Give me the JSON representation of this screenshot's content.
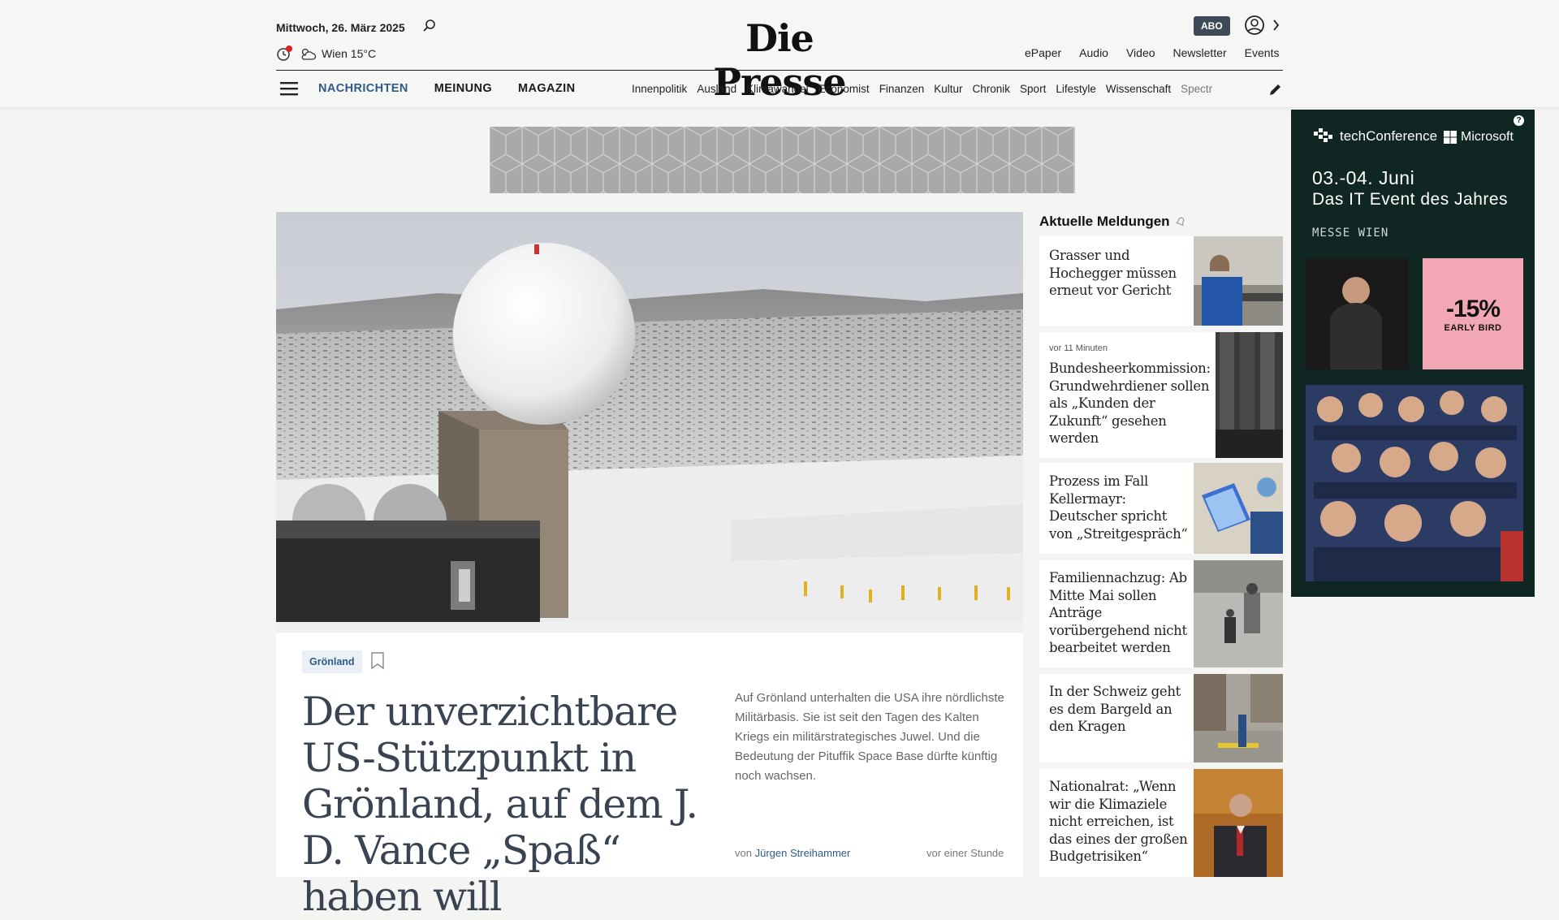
{
  "header": {
    "date": "Mittwoch, 26. März 2025",
    "weather": "Wien 15°C",
    "logo": "Die Presse",
    "abo_label": "ABO",
    "top_links": [
      "ePaper",
      "Audio",
      "Video",
      "Newsletter",
      "Events"
    ]
  },
  "nav": {
    "main": [
      "NACHRICHTEN",
      "MEINUNG",
      "MAGAZIN"
    ],
    "sub": [
      "Innenpolitik",
      "Ausland",
      "Klimawandel",
      "Economist",
      "Finanzen",
      "Kultur",
      "Chronik",
      "Sport",
      "Lifestyle",
      "Wissenschaft",
      "Spectr"
    ]
  },
  "article": {
    "tag": "Grönland",
    "headline": "Der unverzichtbare US-Stützpunkt in Grönland, auf dem J. D. Vance „Spaß“ haben will",
    "teaser": "Auf Grönland unterhalten die USA ihre nördlichste Militärbasis. Sie ist seit den Tagen des Kalten Kriegs ein militärstrategisches Juwel. Und die Bedeutung der Pituffik Space Base dürfte künftig noch wachsen.",
    "author_prefix": "von",
    "author": "Jürgen Streihammer",
    "time": "vor einer Stunde"
  },
  "aktuelle": {
    "title": "Aktuelle Meldungen",
    "items": [
      {
        "meta": "",
        "title": "Grasser und Hochegger müssen erneut vor Gericht"
      },
      {
        "meta": "vor 11 Minuten",
        "title": "Bundesheerkommission: Grundwehrdiener sollen als „Kunden der Zukunft“ gesehen werden"
      },
      {
        "meta": "",
        "title": "Prozess im Fall Kellermayr: Deutscher spricht von „Streitgespräch“"
      },
      {
        "meta": "",
        "title": "Familiennachzug: Ab Mitte Mai sollen Anträge vorübergehend nicht bearbeitet werden"
      },
      {
        "meta": "",
        "title": "In der Schweiz geht es dem Bargeld an den Kragen"
      },
      {
        "meta": "",
        "title": "Nationalrat: „Wenn wir die Klimaziele nicht erreichen, ist das eines der großen Budgetrisiken“"
      }
    ]
  },
  "ad": {
    "brand": "techConference",
    "partner": "Microsoft",
    "dates": "03.-04. Juni",
    "subtitle": "Das IT Event des Jahres",
    "location": "MESSE WIEN",
    "discount": "-15%",
    "discount_label": "EARLY BIRD"
  },
  "colors": {
    "accent": "#2e5b8a",
    "ad_bg": "#0f2623",
    "promo": "#f2a7b4",
    "abo": "#3f4a58"
  }
}
